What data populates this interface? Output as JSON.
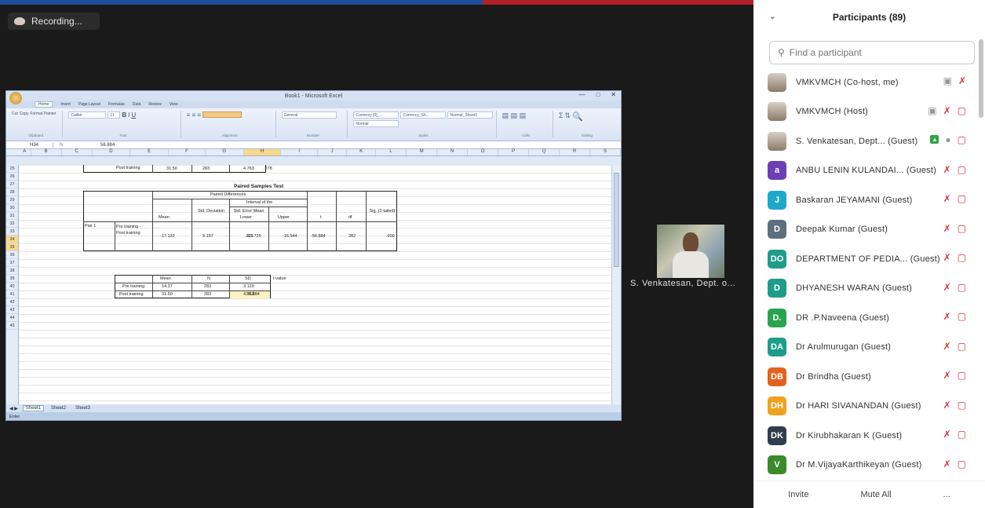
{
  "recording": {
    "label": "Recording..."
  },
  "excel": {
    "window_title": "Book1 - Microsoft Excel",
    "window_buttons": [
      "—",
      "□",
      "✕"
    ],
    "ribbon_tabs": [
      "Home",
      "Insert",
      "Page Layout",
      "Formulas",
      "Data",
      "Review",
      "View"
    ],
    "ribbon": {
      "clipboard": [
        "Cut",
        "Copy",
        "Format Painter"
      ],
      "font_name": "Calibri",
      "font_size": "11",
      "number_format": "General",
      "styles": [
        "Currency [0]_...",
        "Currency_Sh...",
        "Normal_Sheet1",
        "Normal"
      ],
      "groups": [
        "Clipboard",
        "Font",
        "Alignment",
        "Number",
        "Styles",
        "Cells",
        "Editing"
      ]
    },
    "name_box": "H34",
    "formula": "56.884",
    "columns": [
      "A",
      "B",
      "C",
      "D",
      "E",
      "F",
      "G",
      "H",
      "I",
      "J",
      "K",
      "L",
      "M",
      "N",
      "O",
      "P",
      "Q",
      "R",
      "S"
    ],
    "row_numbers": [
      "25",
      "26",
      "27",
      "28",
      "29",
      "30",
      "31",
      "32",
      "33",
      "34",
      "35",
      "36",
      "37",
      "38",
      "39",
      "40",
      "41",
      "42",
      "43",
      "44",
      "45"
    ],
    "row25": {
      "label": "Post training",
      "mean": "31.50",
      "n": "283",
      "sd": "4.763",
      "se": ".278"
    },
    "paired_test": {
      "title": "Paired Samples Test",
      "group_header": "Paired Differences",
      "ci_header": "Interval of the",
      "headers": [
        "Mean",
        "Std. Deviation",
        "Std. Error Mean",
        "Lower",
        "Upper",
        "t",
        "df",
        "Sig. (2-tailed)"
      ],
      "pair_label": "Pair 1",
      "pair_desc": "Pre training - Post training",
      "values": [
        "-17.132",
        "5.197",
        ".301",
        "-17.725",
        "-16.544",
        "-56.884",
        "282",
        ".000"
      ]
    },
    "summary": {
      "headers": [
        "Mean",
        "N",
        "SD",
        "t-value"
      ],
      "rows": [
        {
          "label": "Pre training",
          "mean": "14.37",
          "n": "283",
          "sd": "3.120",
          "t": ""
        },
        {
          "label": "Post training",
          "mean": "31.50",
          "n": "283",
          "sd": "4.763",
          "t": "56.884"
        }
      ]
    },
    "sheets": [
      "Sheet1",
      "Sheet2",
      "Sheet3"
    ],
    "status": "Enter"
  },
  "presenter": {
    "name": "S. Venkatesan, Dept. o..."
  },
  "panel": {
    "title": "Participants (89)",
    "search_placeholder": "Find a participant",
    "participants": [
      {
        "initials": "",
        "color": "#c9b8a8",
        "name": "VMKVMCH (Co-host, me)"
      },
      {
        "initials": "",
        "color": "#c9b8a8",
        "name": "VMKVMCH (Host)"
      },
      {
        "initials": "",
        "color": "#8a7a6a",
        "name": "S. Venkatesan, Dept... (Guest)"
      },
      {
        "initials": "a",
        "color": "#6b3fb5",
        "name": "ANBU LENIN KULANDAI... (Guest)"
      },
      {
        "initials": "J",
        "color": "#1ea8c9",
        "name": "Baskaran JEYAMANI (Guest)"
      },
      {
        "initials": "D",
        "color": "#5d6e7f",
        "name": "Deepak Kumar (Guest)"
      },
      {
        "initials": "DO",
        "color": "#1f9c8a",
        "name": "DEPARTMENT OF PEDIA... (Guest)"
      },
      {
        "initials": "D",
        "color": "#1f9c8a",
        "name": "DHYANESH WARAN (Guest)"
      },
      {
        "initials": "D.",
        "color": "#2aa350",
        "name": "DR .P.Naveena (Guest)"
      },
      {
        "initials": "DA",
        "color": "#1f9c8a",
        "name": "Dr Arulmurugan (Guest)"
      },
      {
        "initials": "DB",
        "color": "#e0641e",
        "name": "Dr Brindha (Guest)"
      },
      {
        "initials": "DH",
        "color": "#f0a21e",
        "name": "Dr HARI SIVANANDAN (Guest)"
      },
      {
        "initials": "DK",
        "color": "#2f3e4e",
        "name": "Dr Kirubhakaran K (Guest)"
      },
      {
        "initials": "V",
        "color": "#3d8a2a",
        "name": "Dr M.VijayaKarthikeyan (Guest)"
      }
    ],
    "footer": {
      "invite": "Invite",
      "mute_all": "Mute All",
      "more": "..."
    }
  }
}
